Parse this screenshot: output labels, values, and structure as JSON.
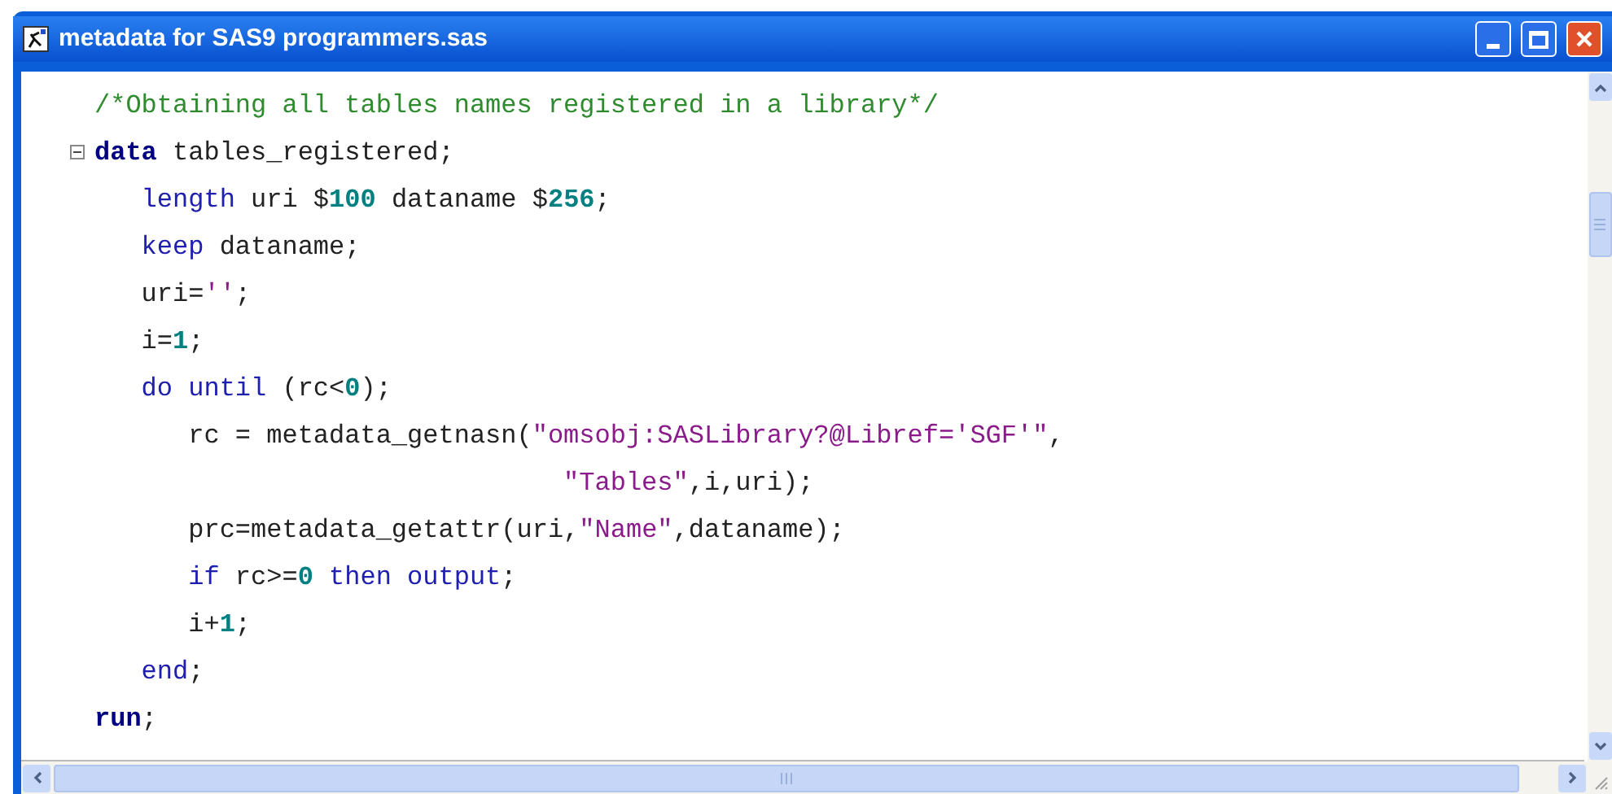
{
  "window": {
    "title": "metadata for SAS9 programmers.sas"
  },
  "editor": {
    "lines": [
      {
        "fold": false,
        "tokens": [
          {
            "kind": "comment",
            "text": "/*Obtaining all tables names registered in a library*/"
          }
        ]
      },
      {
        "fold": true,
        "tokens": [
          {
            "kind": "keyword",
            "text": "data"
          },
          {
            "kind": "plain",
            "text": " tables_registered;"
          }
        ]
      },
      {
        "fold": false,
        "tokens": [
          {
            "kind": "statement",
            "text": "   length"
          },
          {
            "kind": "plain",
            "text": " uri $"
          },
          {
            "kind": "number",
            "text": "100"
          },
          {
            "kind": "plain",
            "text": " dataname $"
          },
          {
            "kind": "number",
            "text": "256"
          },
          {
            "kind": "plain",
            "text": ";"
          }
        ]
      },
      {
        "fold": false,
        "tokens": [
          {
            "kind": "statement",
            "text": "   keep"
          },
          {
            "kind": "plain",
            "text": " dataname;"
          }
        ]
      },
      {
        "fold": false,
        "tokens": [
          {
            "kind": "plain",
            "text": "   uri="
          },
          {
            "kind": "string",
            "text": "''"
          },
          {
            "kind": "plain",
            "text": ";"
          }
        ]
      },
      {
        "fold": false,
        "tokens": [
          {
            "kind": "plain",
            "text": "   i="
          },
          {
            "kind": "number",
            "text": "1"
          },
          {
            "kind": "plain",
            "text": ";"
          }
        ]
      },
      {
        "fold": false,
        "tokens": [
          {
            "kind": "statement",
            "text": "   do until"
          },
          {
            "kind": "plain",
            "text": " (rc<"
          },
          {
            "kind": "number",
            "text": "0"
          },
          {
            "kind": "plain",
            "text": ");"
          }
        ]
      },
      {
        "fold": false,
        "tokens": [
          {
            "kind": "plain",
            "text": "      rc = metadata_getnasn("
          },
          {
            "kind": "string",
            "text": "\"omsobj:SASLibrary?@Libref='SGF'\""
          },
          {
            "kind": "plain",
            "text": ","
          }
        ]
      },
      {
        "fold": false,
        "tokens": [
          {
            "kind": "string",
            "text": "                              \"Tables\""
          },
          {
            "kind": "plain",
            "text": ",i,uri);"
          }
        ]
      },
      {
        "fold": false,
        "tokens": [
          {
            "kind": "plain",
            "text": "      prc=metadata_getattr(uri,"
          },
          {
            "kind": "string",
            "text": "\"Name\""
          },
          {
            "kind": "plain",
            "text": ",dataname);"
          }
        ]
      },
      {
        "fold": false,
        "tokens": [
          {
            "kind": "statement",
            "text": "      if"
          },
          {
            "kind": "plain",
            "text": " rc>="
          },
          {
            "kind": "number",
            "text": "0"
          },
          {
            "kind": "statement",
            "text": " then output"
          },
          {
            "kind": "plain",
            "text": ";"
          }
        ]
      },
      {
        "fold": false,
        "tokens": [
          {
            "kind": "plain",
            "text": "      i+"
          },
          {
            "kind": "number",
            "text": "1"
          },
          {
            "kind": "plain",
            "text": ";"
          }
        ]
      },
      {
        "fold": false,
        "tokens": [
          {
            "kind": "statement",
            "text": "   end"
          },
          {
            "kind": "plain",
            "text": ";"
          }
        ]
      },
      {
        "fold": false,
        "tokens": [
          {
            "kind": "keyword",
            "text": "run"
          },
          {
            "kind": "plain",
            "text": ";"
          }
        ]
      }
    ]
  }
}
